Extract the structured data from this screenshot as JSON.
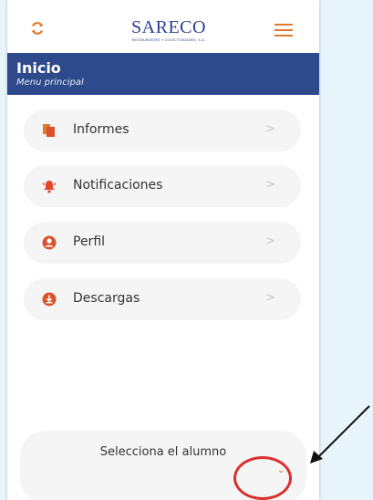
{
  "app": {
    "logo_text": "SARECO",
    "logo_subtitle": "RESTAURANTES Y COLECTIVIDADES, S.A.",
    "refresh_icon": "refresh-icon",
    "menu_icon": "hamburger-menu-icon",
    "accent_color": "#e07b2e",
    "brand_color": "#2c4a8c"
  },
  "header": {
    "title": "Inicio",
    "subtitle": "Menu principal"
  },
  "menu": {
    "items": [
      {
        "label": "Informes",
        "icon": "documents-icon",
        "chevron": ">"
      },
      {
        "label": "Notificaciones",
        "icon": "bell-icon",
        "chevron": ">"
      },
      {
        "label": "Perfil",
        "icon": "user-circle-icon",
        "chevron": ">"
      },
      {
        "label": "Descargas",
        "icon": "download-circle-icon",
        "chevron": ">"
      }
    ]
  },
  "student_selector": {
    "label": "Selecciona el alumno",
    "chevron": "⌄"
  },
  "annotation": {
    "ring_color": "#d9302b",
    "arrow_color": "#111111"
  }
}
